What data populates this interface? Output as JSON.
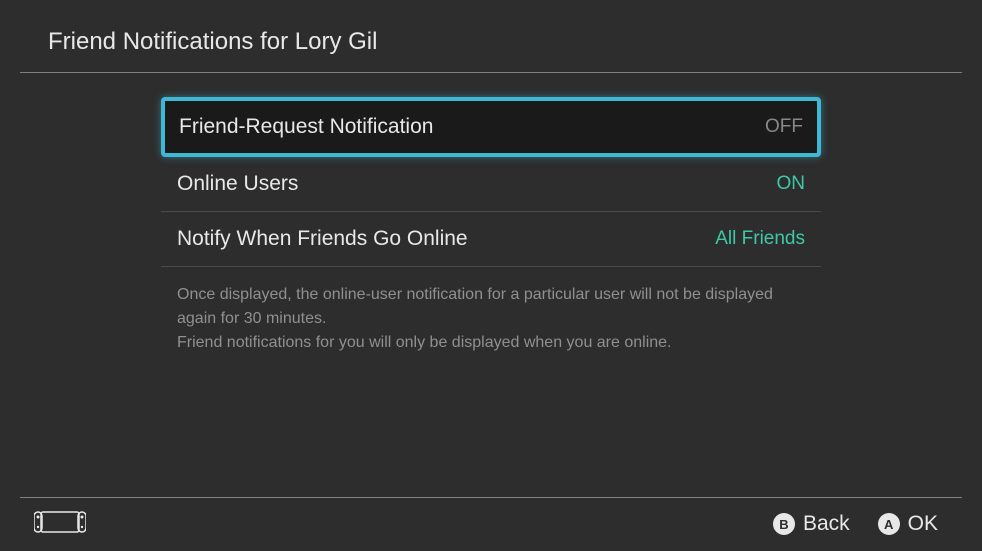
{
  "header": {
    "title": "Friend Notifications for Lory Gil"
  },
  "settings": {
    "friendRequest": {
      "label": "Friend-Request Notification",
      "value": "OFF"
    },
    "onlineUsers": {
      "label": "Online Users",
      "value": "ON"
    },
    "notifyOnline": {
      "label": "Notify When Friends Go Online",
      "value": "All Friends"
    }
  },
  "helpText": {
    "line1": "Once displayed, the online-user notification for a particular user will not be displayed again for 30 minutes.",
    "line2": "Friend notifications for you will only be displayed when you are online."
  },
  "footer": {
    "back": {
      "glyph": "B",
      "label": "Back"
    },
    "ok": {
      "glyph": "A",
      "label": "OK"
    }
  }
}
